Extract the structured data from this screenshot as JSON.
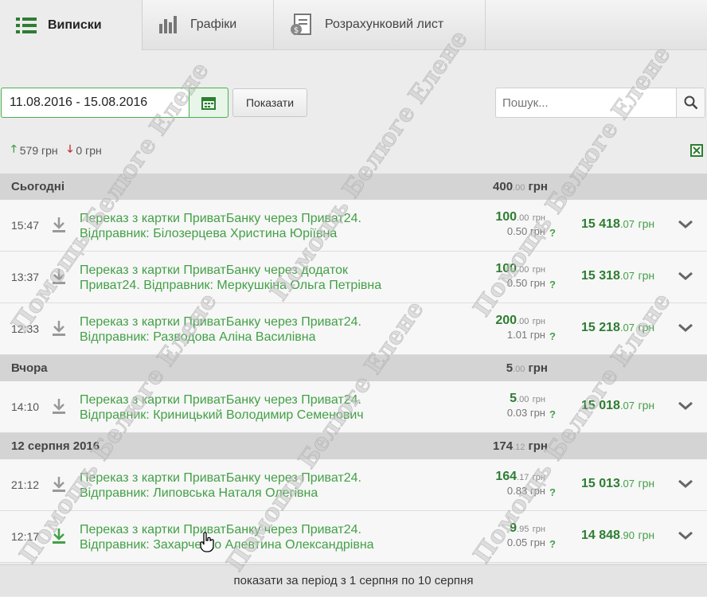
{
  "tabs": [
    {
      "label": "Виписки",
      "icon": "list-icon",
      "active": true
    },
    {
      "label": "Графіки",
      "icon": "bar-chart-icon",
      "active": false
    },
    {
      "label": "Розрахунковий лист",
      "icon": "payslip-icon",
      "active": false
    }
  ],
  "filters": {
    "date_range": "11.08.2016 - 15.08.2016",
    "show_label": "Показати",
    "search_placeholder": "Пошук..."
  },
  "totals": {
    "income": "579 грн",
    "expense": "0 грн"
  },
  "groups": [
    {
      "label": "Сьогодні",
      "sum_int": "400",
      "sum_dec": ".00",
      "sum_cur": "грн",
      "rows": [
        {
          "time": "15:47",
          "line1": "Переказ з картки ПриватБанку через Приват24.",
          "line2": "Відправник: Білозерцева Христина Юріївна",
          "amount_int": "100",
          "amount_dec": ".00",
          "cur": "грн",
          "fee": "0.50 грн",
          "balance_int": "15 418",
          "balance_dec": ".07",
          "downloaded": false
        },
        {
          "time": "13:37",
          "line1": "Переказ з картки ПриватБанку через додаток",
          "line2": "Приват24. Відправник: Меркушкіна Ольга Петрівна",
          "amount_int": "100",
          "amount_dec": ".00",
          "cur": "грн",
          "fee": "0.50 грн",
          "balance_int": "15 318",
          "balance_dec": ".07",
          "downloaded": false
        },
        {
          "time": "12:33",
          "line1": "Переказ з картки ПриватБанку через Приват24.",
          "line2": "Відправник: Разводова Аліна Василівна",
          "amount_int": "200",
          "amount_dec": ".00",
          "cur": "грн",
          "fee": "1.01 грн",
          "balance_int": "15 218",
          "balance_dec": ".07",
          "downloaded": false
        }
      ]
    },
    {
      "label": "Вчора",
      "sum_int": "5",
      "sum_dec": ".00",
      "sum_cur": "грн",
      "rows": [
        {
          "time": "14:10",
          "line1": "Переказ з картки ПриватБанку через Приват24.",
          "line2": "Відправник: Криницький Володимир Семенович",
          "amount_int": "5",
          "amount_dec": ".00",
          "cur": "грн",
          "fee": "0.03 грн",
          "balance_int": "15 018",
          "balance_dec": ".07",
          "downloaded": false
        }
      ]
    },
    {
      "label": "12 серпня 2016",
      "sum_int": "174",
      "sum_dec": ".12",
      "sum_cur": "грн",
      "rows": [
        {
          "time": "21:12",
          "line1": "Переказ з картки ПриватБанку через Приват24.",
          "line2": "Відправник: Липовська Наталя Олегівна",
          "amount_int": "164",
          "amount_dec": ".17",
          "cur": "грн",
          "fee": "0.83 грн",
          "balance_int": "15 013",
          "balance_dec": ".07",
          "downloaded": false
        },
        {
          "time": "12:17",
          "line1": "Переказ з картки ПриватБанку через Приват24.",
          "line2": "Відправник: Захарченко Алевтина Олександрівна",
          "amount_int": "9",
          "amount_dec": ".95",
          "cur": "грн",
          "fee": "0.05 грн",
          "balance_int": "14 848",
          "balance_dec": ".90",
          "downloaded": true
        }
      ]
    }
  ],
  "balance_currency": "грн",
  "fee_help": "?",
  "footer_link": "показати за період з 1 серпня по 10 серпня",
  "watermark": "Помощь Белюге Елене",
  "colors": {
    "accent": "#43a047",
    "amount": "#2e7d32",
    "group_bg": "#d4d4d4"
  }
}
